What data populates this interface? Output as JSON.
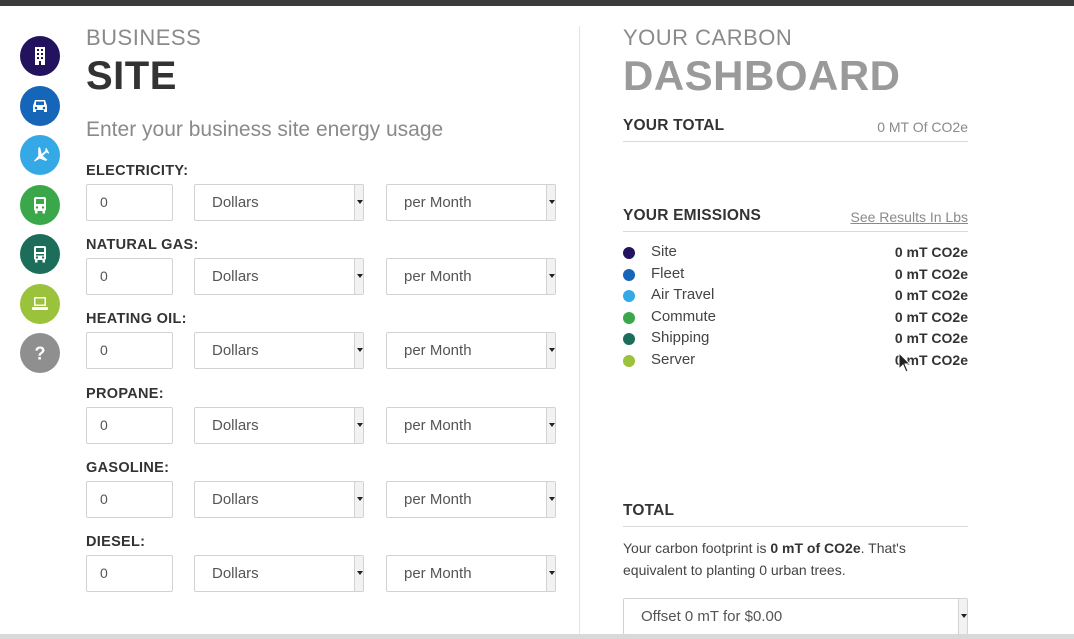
{
  "rail": [
    {
      "icon": "building-icon",
      "color": "#23125e"
    },
    {
      "icon": "car-icon",
      "color": "#1565b8"
    },
    {
      "icon": "airplane-icon",
      "color": "#35a9e5"
    },
    {
      "icon": "bus-icon",
      "color": "#3aa84a"
    },
    {
      "icon": "truck-icon",
      "color": "#1c6e5a"
    },
    {
      "icon": "laptop-icon",
      "color": "#9bc23b"
    },
    {
      "icon": "help-icon",
      "color": "#8f8f8f"
    }
  ],
  "site": {
    "kicker": "BUSINESS",
    "title": "SITE",
    "subtitle": "Enter your business site energy usage",
    "fuels": [
      {
        "label": "ELECTRICITY:",
        "value": "0",
        "unit": "Dollars",
        "period": "per Month"
      },
      {
        "label": "NATURAL GAS:",
        "value": "0",
        "unit": "Dollars",
        "period": "per Month"
      },
      {
        "label": "HEATING OIL:",
        "value": "0",
        "unit": "Dollars",
        "period": "per Month"
      },
      {
        "label": "PROPANE:",
        "value": "0",
        "unit": "Dollars",
        "period": "per Month"
      },
      {
        "label": "GASOLINE:",
        "value": "0",
        "unit": "Dollars",
        "period": "per Month"
      },
      {
        "label": "DIESEL:",
        "value": "0",
        "unit": "Dollars",
        "period": "per Month"
      }
    ]
  },
  "dashboard": {
    "kicker": "YOUR CARBON",
    "title": "DASHBOARD",
    "total": {
      "label": "YOUR TOTAL",
      "value": "0 MT Of CO2e"
    },
    "emissions": {
      "label": "YOUR EMISSIONS",
      "link": "See Results In Lbs",
      "items": [
        {
          "name": "Site",
          "value": "0 mT CO2e",
          "color": "#23125e"
        },
        {
          "name": "Fleet",
          "value": "0 mT CO2e",
          "color": "#1565b8"
        },
        {
          "name": "Air Travel",
          "value": "0 mT CO2e",
          "color": "#35a9e5"
        },
        {
          "name": "Commute",
          "value": "0 mT CO2e",
          "color": "#3aa84a"
        },
        {
          "name": "Shipping",
          "value": "0 mT CO2e",
          "color": "#1c6e5a"
        },
        {
          "name": "Server",
          "value": "0 mT CO2e",
          "color": "#9bc23b"
        }
      ]
    },
    "summary": {
      "label": "TOTAL",
      "text_before": "Your carbon footprint is ",
      "amount": "0 mT of CO2e",
      "text_after": ". That's equivalent to planting 0 urban trees."
    },
    "offset_option": "Offset 0 mT for $0.00"
  }
}
